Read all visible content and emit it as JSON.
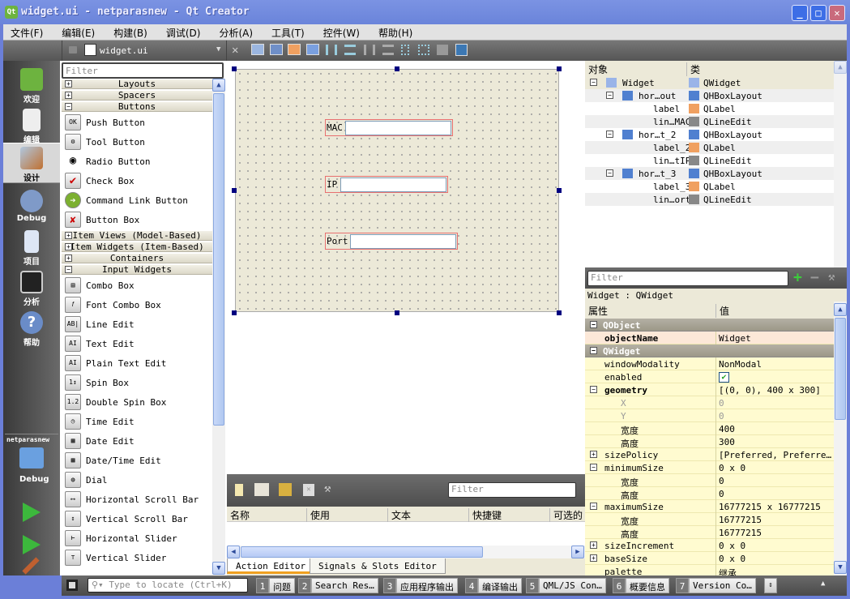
{
  "window": {
    "title": "widget.ui - netparasnew - Qt Creator",
    "logo": "Qt",
    "minimize": "_",
    "maximize": "□",
    "close": "✕"
  },
  "menu": [
    "文件(F)",
    "编辑(E)",
    "构建(B)",
    "调试(D)",
    "分析(A)",
    "工具(T)",
    "控件(W)",
    "帮助(H)"
  ],
  "editor": {
    "file": "widget.ui",
    "lock_icon": "lock-open-icon",
    "close": "✕"
  },
  "toolbar_icons": [
    "edit-widgets",
    "edit-signals-slots",
    "edit-buddies",
    "edit-tab-order",
    "layout-horizontal",
    "layout-vertical",
    "layout-horizontal-splitter",
    "layout-vertical-splitter",
    "layout-grid",
    "layout-form",
    "break-layout",
    "adjust-size"
  ],
  "modes": [
    {
      "label": "欢迎",
      "icon": "qt-welcome-icon"
    },
    {
      "label": "编辑",
      "icon": "edit-document-icon"
    },
    {
      "label": "设计",
      "icon": "design-brush-icon",
      "active": true
    },
    {
      "label": "Debug",
      "icon": "bug-icon"
    },
    {
      "label": "项目",
      "icon": "project-folder-icon"
    },
    {
      "label": "分析",
      "icon": "analyze-monitor-icon"
    },
    {
      "label": "帮助",
      "icon": "help-icon"
    }
  ],
  "target": {
    "project": "netparasnew",
    "label": "Debug"
  },
  "widgetbox": {
    "filter_placeholder": "Filter",
    "categories": {
      "layouts": "Layouts",
      "spacers": "Spacers",
      "buttons": "Buttons",
      "item_views": "Item Views (Model-Based)",
      "item_widgets": "Item Widgets (Item-Based)",
      "containers": "Containers",
      "input": "Input Widgets"
    },
    "buttons": [
      "Push Button",
      "Tool Button",
      "Radio Button",
      "Check Box",
      "Command Link Button",
      "Button Box"
    ],
    "inputs": [
      "Combo Box",
      "Font Combo Box",
      "Line Edit",
      "Text Edit",
      "Plain Text Edit",
      "Spin Box",
      "Double Spin Box",
      "Time Edit",
      "Date Edit",
      "Date/Time Edit",
      "Dial",
      "Horizontal Scroll Bar",
      "Vertical Scroll Bar",
      "Horizontal Slider",
      "Vertical Slider"
    ]
  },
  "form": {
    "labels": [
      "MAC",
      "IP",
      "Port"
    ]
  },
  "action_editor": {
    "filter_placeholder": "Filter",
    "columns": [
      "名称",
      "使用",
      "文本",
      "快捷键",
      "可选的"
    ],
    "tabs": [
      "Action Editor",
      "Signals & Slots Editor"
    ]
  },
  "object_inspector": {
    "columns": [
      "对象",
      "类"
    ],
    "rows": [
      {
        "name": "Widget",
        "class": "QWidget"
      },
      {
        "name": "hor…out",
        "class": "QHBoxLayout"
      },
      {
        "name": "label",
        "class": "QLabel"
      },
      {
        "name": "lin…MAC",
        "class": "QLineEdit"
      },
      {
        "name": "hor…t_2",
        "class": "QHBoxLayout"
      },
      {
        "name": "label_2",
        "class": "QLabel"
      },
      {
        "name": "lin…tIP",
        "class": "QLineEdit"
      },
      {
        "name": "hor…t_3",
        "class": "QHBoxLayout"
      },
      {
        "name": "label_3",
        "class": "QLabel"
      },
      {
        "name": "lin…ort",
        "class": "QLineEdit"
      }
    ]
  },
  "property_editor": {
    "filter_placeholder": "Filter",
    "class_label": "Widget : QWidget",
    "columns": [
      "属性",
      "值"
    ],
    "rows": [
      {
        "name": "QObject",
        "value": ""
      },
      {
        "name": "objectName",
        "value": "Widget"
      },
      {
        "name": "QWidget",
        "value": ""
      },
      {
        "name": "windowModality",
        "value": "NonModal"
      },
      {
        "name": "enabled",
        "value": "✔"
      },
      {
        "name": "geometry",
        "value": "[(0, 0), 400 x 300]"
      },
      {
        "name": "X",
        "value": "0"
      },
      {
        "name": "Y",
        "value": "0"
      },
      {
        "name": "宽度",
        "value": "400"
      },
      {
        "name": "高度",
        "value": "300"
      },
      {
        "name": "sizePolicy",
        "value": "[Preferred, Preferre…"
      },
      {
        "name": "minimumSize",
        "value": "0 x 0"
      },
      {
        "name": "宽度",
        "value": "0"
      },
      {
        "name": "高度",
        "value": "0"
      },
      {
        "name": "maximumSize",
        "value": "16777215 x 16777215"
      },
      {
        "name": "宽度",
        "value": "16777215"
      },
      {
        "name": "高度",
        "value": "16777215"
      },
      {
        "name": "sizeIncrement",
        "value": "0 x 0"
      },
      {
        "name": "baseSize",
        "value": "0 x 0"
      },
      {
        "name": "palette",
        "value": "继承"
      }
    ]
  },
  "statusbar": {
    "locate_placeholder": "Type to locate (Ctrl+K)",
    "panes": [
      {
        "num": "1",
        "label": "问题"
      },
      {
        "num": "2",
        "label": "Search Res…"
      },
      {
        "num": "3",
        "label": "应用程序输出"
      },
      {
        "num": "4",
        "label": "编译输出"
      },
      {
        "num": "5",
        "label": "QML/JS Con…"
      },
      {
        "num": "6",
        "label": "概要信息"
      },
      {
        "num": "7",
        "label": "Version Co…"
      }
    ]
  }
}
